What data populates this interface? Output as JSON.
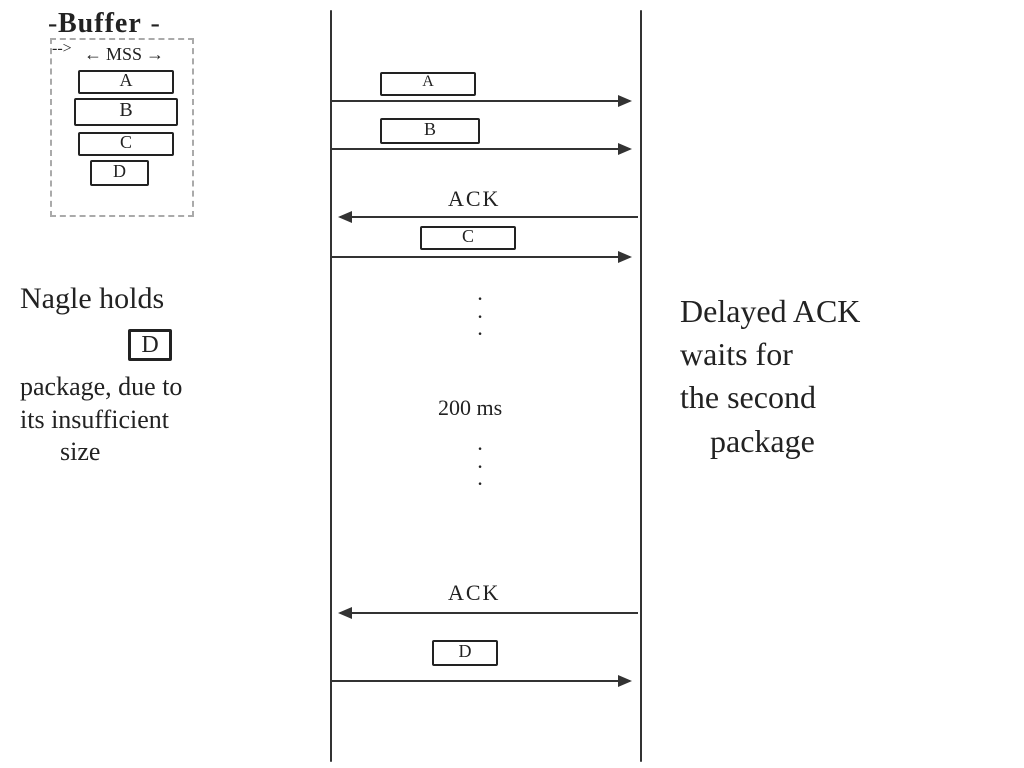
{
  "buffer": {
    "title": "Buffer",
    "mss": "MSS",
    "items": [
      "A",
      "B",
      "C",
      "D"
    ]
  },
  "timeline": {
    "events": {
      "send_a": "A",
      "send_b": "B",
      "ack1": "ACK",
      "send_c": "C",
      "delay": "200 ms",
      "ack2": "ACK",
      "send_d": "D"
    }
  },
  "left_note": {
    "line1": "Nagle holds",
    "boxed": "D",
    "line2": "package, due to",
    "line3": "its insufficient",
    "line4": "size"
  },
  "right_note": {
    "line1": "Delayed ACK",
    "line2": "waits for",
    "line3": "the second",
    "line4": "package"
  }
}
